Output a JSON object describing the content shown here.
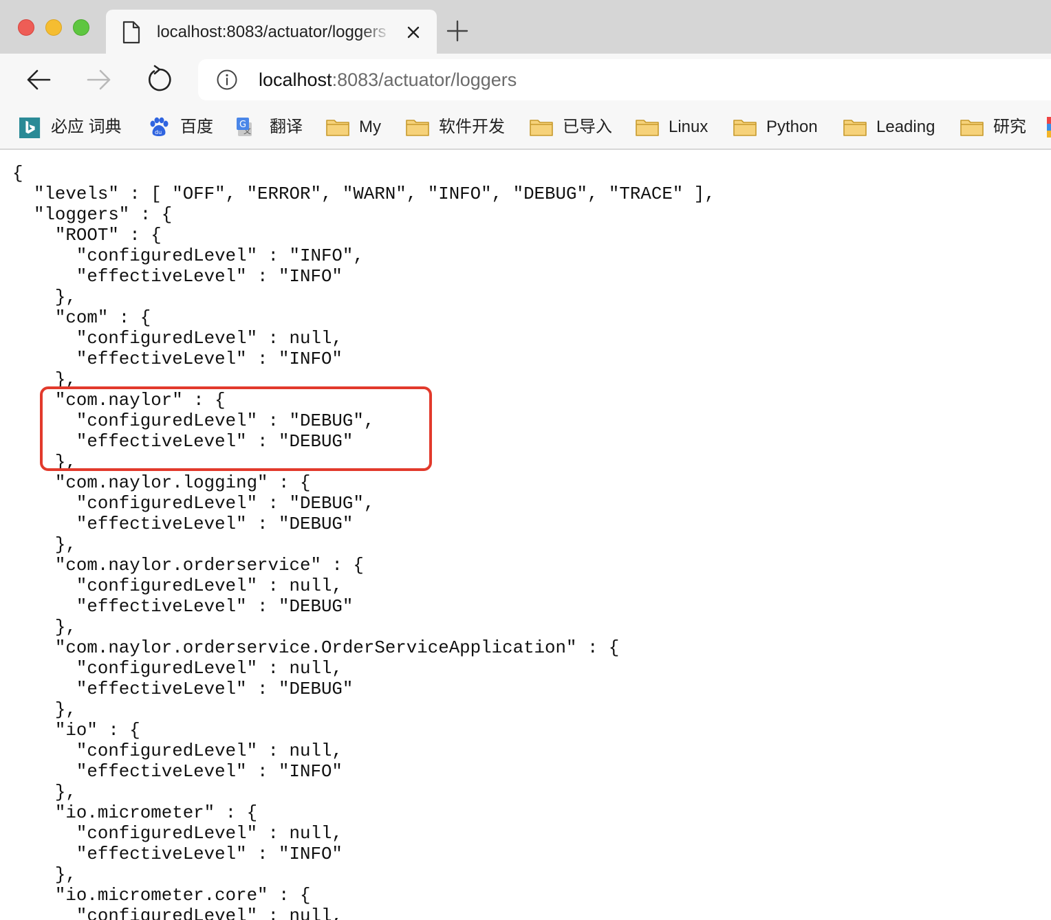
{
  "window": {
    "tab": {
      "title": "localhost:8083/actuator/loggers"
    },
    "address": {
      "host": "localhost",
      "rest": ":8083/actuator/loggers"
    }
  },
  "bookmarks": [
    {
      "label": "必应 词典",
      "icon": "bing-icon"
    },
    {
      "label": "百度",
      "icon": "baidu-icon"
    },
    {
      "label": "翻译",
      "icon": "translate-icon"
    },
    {
      "label": "My",
      "icon": "folder-icon"
    },
    {
      "label": "软件开发",
      "icon": "folder-icon"
    },
    {
      "label": "已导入",
      "icon": "folder-icon"
    },
    {
      "label": "Linux",
      "icon": "folder-icon"
    },
    {
      "label": "Python",
      "icon": "folder-icon"
    },
    {
      "label": "Leading",
      "icon": "folder-icon"
    },
    {
      "label": "研究",
      "icon": "folder-icon"
    }
  ],
  "json_lines": [
    "{",
    "  \"levels\" : [ \"OFF\", \"ERROR\", \"WARN\", \"INFO\", \"DEBUG\", \"TRACE\" ],",
    "  \"loggers\" : {",
    "    \"ROOT\" : {",
    "      \"configuredLevel\" : \"INFO\",",
    "      \"effectiveLevel\" : \"INFO\"",
    "    },",
    "    \"com\" : {",
    "      \"configuredLevel\" : null,",
    "      \"effectiveLevel\" : \"INFO\"",
    "    },",
    "    \"com.naylor\" : {",
    "      \"configuredLevel\" : \"DEBUG\",",
    "      \"effectiveLevel\" : \"DEBUG\"",
    "    },",
    "    \"com.naylor.logging\" : {",
    "      \"configuredLevel\" : \"DEBUG\",",
    "      \"effectiveLevel\" : \"DEBUG\"",
    "    },",
    "    \"com.naylor.orderservice\" : {",
    "      \"configuredLevel\" : null,",
    "      \"effectiveLevel\" : \"DEBUG\"",
    "    },",
    "    \"com.naylor.orderservice.OrderServiceApplication\" : {",
    "      \"configuredLevel\" : null,",
    "      \"effectiveLevel\" : \"DEBUG\"",
    "    },",
    "    \"io\" : {",
    "      \"configuredLevel\" : null,",
    "      \"effectiveLevel\" : \"INFO\"",
    "    },",
    "    \"io.micrometer\" : {",
    "      \"configuredLevel\" : null,",
    "      \"effectiveLevel\" : \"INFO\"",
    "    },",
    "    \"io.micrometer.core\" : {",
    "      \"configuredLevel\" : null,"
  ],
  "annotation": {
    "color": "#e23a2c"
  }
}
